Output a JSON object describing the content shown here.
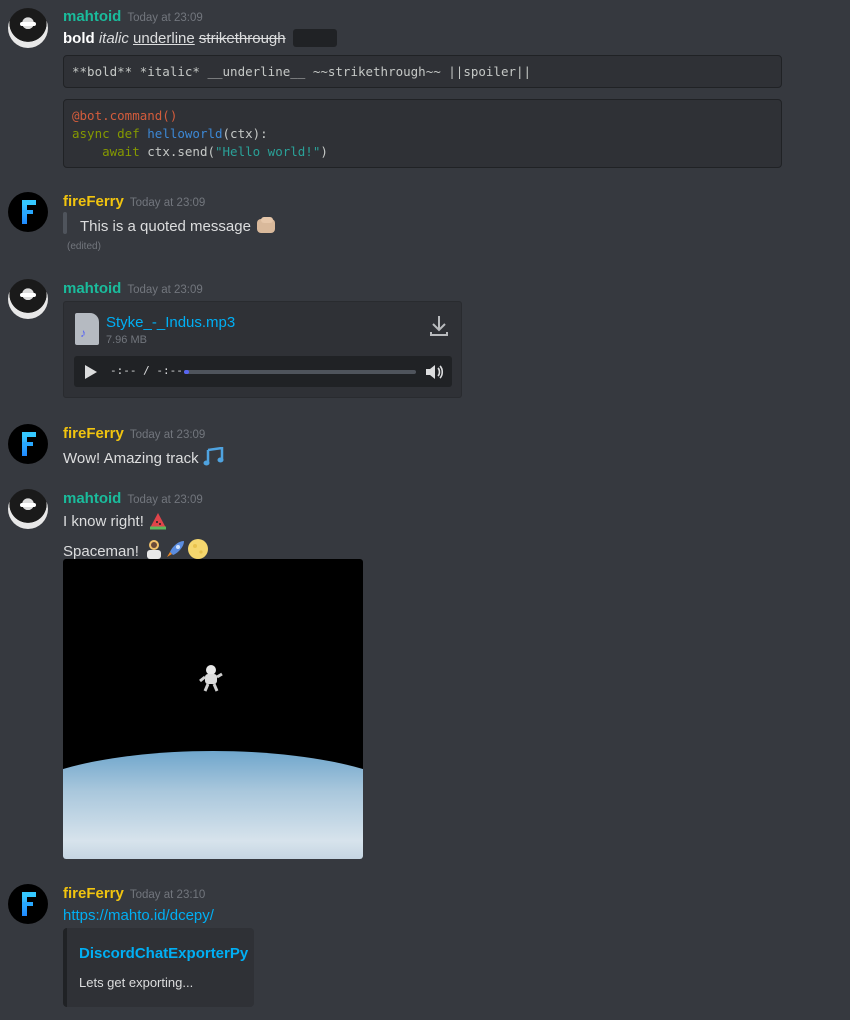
{
  "messages": {
    "m1": {
      "author": "mahtoid",
      "timestamp": "Today at 23:09",
      "rich": {
        "bold": "bold",
        "italic": "italic",
        "underline": "underline",
        "strike": "strikethrough"
      },
      "markdown_source": "**bold** *italic* __underline__ ~~strikethrough~~ ||spoiler||",
      "code": {
        "line1": "@bot.command()",
        "line2_kw": "async def ",
        "line2_fn": "helloworld",
        "line2_rest": "(ctx):",
        "line3_kw": "    await ",
        "line3_plain": "ctx.send(",
        "line3_str": "\"Hello world!\"",
        "line3_end": ")"
      }
    },
    "m2": {
      "author": "fireFerry",
      "timestamp": "Today at 23:09",
      "quote": "This is a quoted message",
      "edited": "(edited)"
    },
    "m3": {
      "author": "mahtoid",
      "timestamp": "Today at 23:09",
      "file_name": "Styke_-_Indus.mp3",
      "file_size": "7.96 MB",
      "player_time": "-:-- / -:--",
      "progress": 0.02
    },
    "m4": {
      "author": "fireFerry",
      "timestamp": "Today at 23:09",
      "text": "Wow! Amazing track"
    },
    "m5": {
      "author": "mahtoid",
      "timestamp": "Today at 23:09",
      "text1": "I know right!",
      "text2": "Spaceman!"
    },
    "m6": {
      "author": "fireFerry",
      "timestamp": "Today at 23:10",
      "link": "https://mahto.id/dcepy/",
      "embed_title": "DiscordChatExporterPy",
      "embed_desc": "Lets get exporting..."
    }
  },
  "colors": {
    "mahtoid": "#1abc9c",
    "fireFerry": "#f1c40f",
    "link": "#00aff4",
    "background": "#36393f"
  }
}
